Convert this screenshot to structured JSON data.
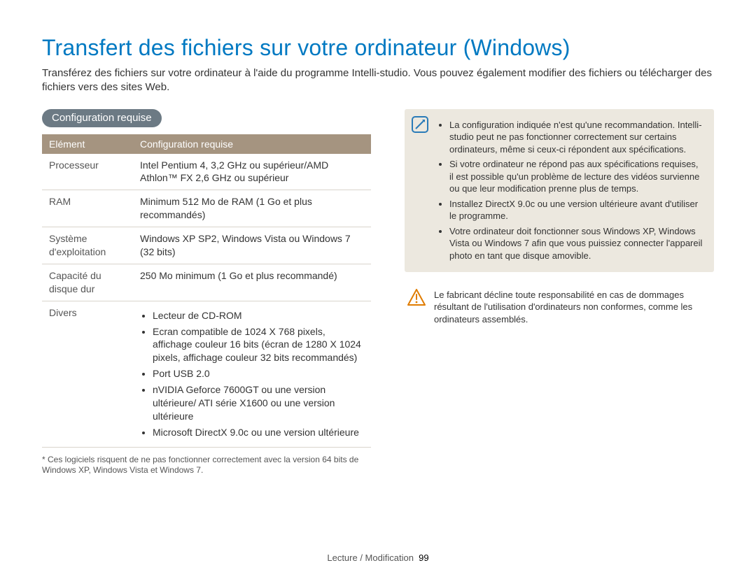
{
  "title": "Transfert des fichiers sur votre ordinateur (Windows)",
  "intro": "Transférez des fichiers sur votre ordinateur à l'aide du programme Intelli-studio. Vous pouvez également modifier des fichiers ou télécharger des fichiers vers des sites Web.",
  "config_pill": "Configuration requise",
  "table": {
    "header_element": "Elément",
    "header_config": "Configuration requise",
    "rows": {
      "processor_label": "Processeur",
      "processor_value": "Intel Pentium 4, 3,2 GHz ou supérieur/AMD Athlon™ FX 2,6 GHz ou supérieur",
      "ram_label": "RAM",
      "ram_value": "Minimum 512 Mo de RAM (1 Go et plus recommandés)",
      "os_label": "Système d'exploitation",
      "os_value": "Windows XP SP2, Windows Vista ou Windows 7 (32 bits)",
      "disk_label": "Capacité du disque dur",
      "disk_value": "250 Mo minimum (1 Go et plus recommandé)",
      "misc_label": "Divers",
      "misc_items": {
        "i1": "Lecteur de CD-ROM",
        "i2": "Ecran compatible de 1024 X 768 pixels, affichage couleur 16 bits (écran de 1280 X 1024 pixels, affichage couleur 32 bits recommandés)",
        "i3": "Port USB 2.0",
        "i4": "nVIDIA Geforce 7600GT ou une version ultérieure/ ATI série X1600 ou une version ultérieure",
        "i5": "Microsoft DirectX 9.0c ou une version ultérieure"
      }
    }
  },
  "footnote": "* Ces logiciels risquent de ne pas fonctionner correctement avec la version 64 bits de Windows XP, Windows Vista et Windows 7.",
  "note_items": {
    "n1": "La configuration indiquée n'est qu'une recommandation. Intelli-studio peut ne pas fonctionner correctement sur certains ordinateurs, même si ceux-ci répondent aux spécifications.",
    "n2": "Si votre ordinateur ne répond pas aux spécifications requises, il est possible qu'un problème de lecture des vidéos survienne ou que leur modification prenne plus de temps.",
    "n3": "Installez DirectX 9.0c ou une version ultérieure avant d'utiliser le programme.",
    "n4": "Votre ordinateur doit fonctionner sous Windows XP, Windows Vista ou Windows 7 afin que vous puissiez connecter l'appareil photo en tant que disque amovible."
  },
  "warning": "Le fabricant décline toute responsabilité en cas de dommages résultant de l'utilisation d'ordinateurs non conformes, comme les ordinateurs assemblés.",
  "footer": {
    "section": "Lecture / Modification",
    "page": "99"
  }
}
